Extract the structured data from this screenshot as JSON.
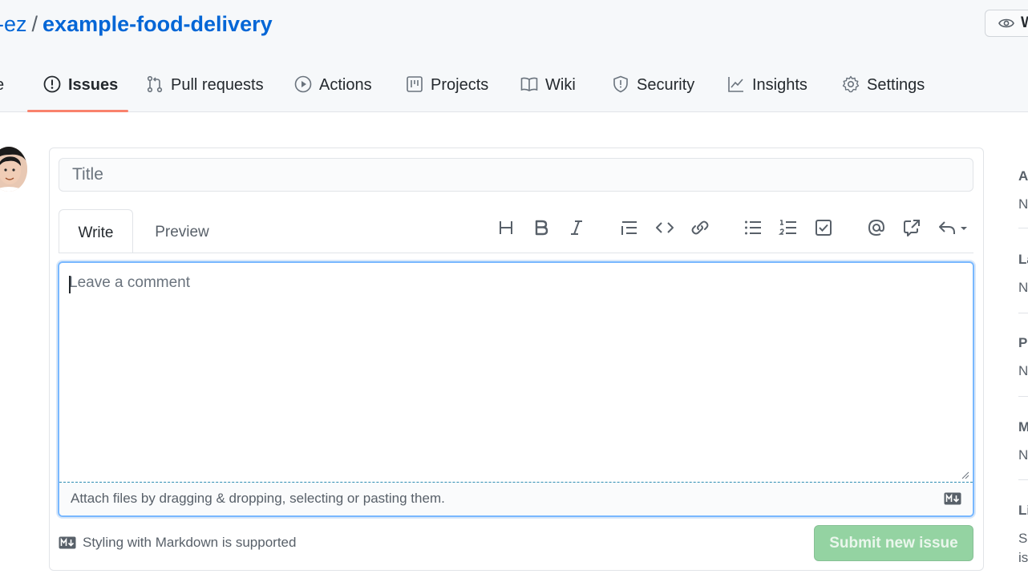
{
  "header": {
    "owner": "-ez",
    "separator": "/",
    "repo": "example-food-delivery",
    "watch_label": "W"
  },
  "tabs": [
    {
      "id": "code",
      "label": "e",
      "icon": "code-icon"
    },
    {
      "id": "issues",
      "label": "Issues",
      "icon": "issue-opened-icon",
      "active": true
    },
    {
      "id": "pulls",
      "label": "Pull requests",
      "icon": "git-pull-request-icon"
    },
    {
      "id": "actions",
      "label": "Actions",
      "icon": "play-icon"
    },
    {
      "id": "projects",
      "label": "Projects",
      "icon": "project-icon"
    },
    {
      "id": "wiki",
      "label": "Wiki",
      "icon": "book-icon"
    },
    {
      "id": "security",
      "label": "Security",
      "icon": "shield-icon"
    },
    {
      "id": "insights",
      "label": "Insights",
      "icon": "graph-icon"
    },
    {
      "id": "settings",
      "label": "Settings",
      "icon": "gear-icon"
    }
  ],
  "form": {
    "title_placeholder": "Title",
    "title_value": "",
    "write_tab": "Write",
    "preview_tab": "Preview",
    "comment_placeholder": "Leave a comment",
    "comment_value": "",
    "attach_text": "Attach files by dragging & dropping, selecting or pasting them.",
    "markdown_note": "Styling with Markdown is supported",
    "submit_label": "Submit new issue"
  },
  "toolbar": [
    "heading-icon",
    "bold-icon",
    "italic-icon",
    "quote-icon",
    "code-icon",
    "link-icon",
    "unordered-list-icon",
    "ordered-list-icon",
    "task-list-icon",
    "mention-icon",
    "cross-reference-icon",
    "reply-icon"
  ],
  "sidebar": [
    {
      "head": "A",
      "value": "N"
    },
    {
      "head": "La",
      "value": "N"
    },
    {
      "head": "Pr",
      "value": "N"
    },
    {
      "head": "M",
      "value": "N"
    },
    {
      "head": "Li",
      "value": "Su",
      "value2": "is"
    }
  ],
  "colors": {
    "link": "#0366d6",
    "active_tab_underline": "#f9826c",
    "submit_disabled": "#94d3a2",
    "focus_border": "#79b8ff"
  }
}
